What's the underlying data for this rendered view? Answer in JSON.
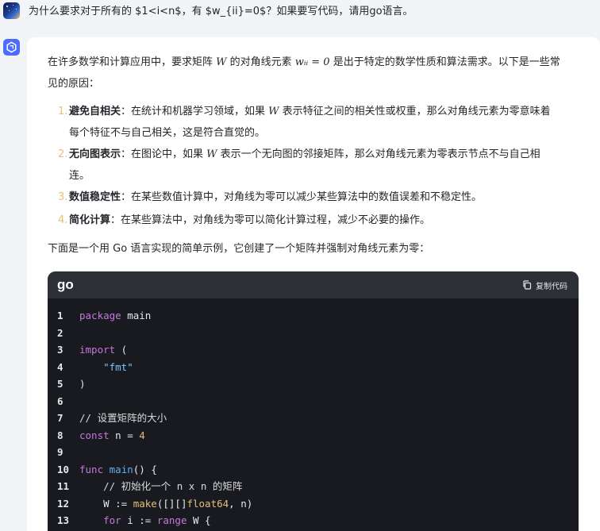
{
  "user_message": {
    "text": "为什么要求对于所有的 $1<i<n$，有 $w_{ii}=0$？如果要写代码，请用go语言。"
  },
  "answer": {
    "intro_line1_a": "在许多数学和计算应用中，要求矩阵 ",
    "intro_W": "W",
    "intro_line1_b": " 的对角线元素 ",
    "intro_wii": "wᵢᵢ = 0",
    "intro_line1_c": " 是出于特定的数学性质和算法需求。以下是一些常",
    "intro_line2": "见的原因：",
    "items": [
      {
        "num": "1.",
        "title": "避免自相关",
        "text_a": "：在统计和机器学习领域，如果 ",
        "var": "W",
        "text_b": " 表示特征之间的相关性或权重，那么对角线元素为零意味着",
        "cont": "每个特征不与自己相关，这是符合直觉的。"
      },
      {
        "num": "2.",
        "title": "无向图表示",
        "text_a": "：在图论中，如果 ",
        "var": "W",
        "text_b": " 表示一个无向图的邻接矩阵，那么对角线元素为零表示节点不与自己相",
        "cont": "连。"
      },
      {
        "num": "3.",
        "title": "数值稳定性",
        "text_a": "：在某些数值计算中，对角线为零可以减少某些算法中的数值误差和不稳定性。",
        "var": "",
        "text_b": "",
        "cont": ""
      },
      {
        "num": "4.",
        "title": "简化计算",
        "text_a": "：在某些算法中，对角线为零可以简化计算过程，减少不必要的操作。",
        "var": "",
        "text_b": "",
        "cont": ""
      }
    ],
    "code_intro": "下面是一个用 Go 语言实现的简单示例，它创建了一个矩阵并强制对角线元素为零："
  },
  "code_block": {
    "language": "go",
    "copy_label": "复制代码",
    "lines": [
      {
        "n": "1",
        "tokens": [
          [
            "kw",
            "package"
          ],
          [
            "id",
            " main"
          ]
        ]
      },
      {
        "n": "2",
        "tokens": []
      },
      {
        "n": "3",
        "tokens": [
          [
            "kw",
            "import"
          ],
          [
            "id",
            " ("
          ]
        ]
      },
      {
        "n": "4",
        "tokens": [
          [
            "id",
            "    "
          ],
          [
            "str2",
            "\"fmt\""
          ]
        ]
      },
      {
        "n": "5",
        "tokens": [
          [
            "id",
            ")"
          ]
        ]
      },
      {
        "n": "6",
        "tokens": []
      },
      {
        "n": "7",
        "tokens": [
          [
            "cm",
            "// 设置矩阵的大小"
          ]
        ]
      },
      {
        "n": "8",
        "tokens": [
          [
            "kw",
            "const"
          ],
          [
            "id",
            " n = "
          ],
          [
            "num",
            "4"
          ]
        ]
      },
      {
        "n": "9",
        "tokens": []
      },
      {
        "n": "10",
        "tokens": [
          [
            "kw",
            "func"
          ],
          [
            "id",
            " "
          ],
          [
            "fn",
            "main"
          ],
          [
            "id",
            "() {"
          ]
        ]
      },
      {
        "n": "11",
        "tokens": [
          [
            "id",
            "    "
          ],
          [
            "cm",
            "// 初始化一个 n x n 的矩阵"
          ]
        ]
      },
      {
        "n": "12",
        "tokens": [
          [
            "id",
            "    W := "
          ],
          [
            "ty",
            "make"
          ],
          [
            "id",
            "([][]"
          ],
          [
            "ty",
            "float64"
          ],
          [
            "id",
            ", n)"
          ]
        ]
      },
      {
        "n": "13",
        "tokens": [
          [
            "id",
            "    "
          ],
          [
            "kw",
            "for"
          ],
          [
            "id",
            " i := "
          ],
          [
            "kw",
            "range"
          ],
          [
            "id",
            " W {"
          ]
        ]
      }
    ]
  },
  "colors": {
    "page_bg": "#f3f4f8",
    "card_bg": "#ffffff",
    "code_bg": "#181a20",
    "code_header_bg": "#2e3037",
    "bot_avatar": "#4d6bfe"
  },
  "icons": {
    "user_avatar": "night-sky-avatar",
    "bot_avatar": "hexagon-logo-icon",
    "copy": "copy-icon"
  }
}
